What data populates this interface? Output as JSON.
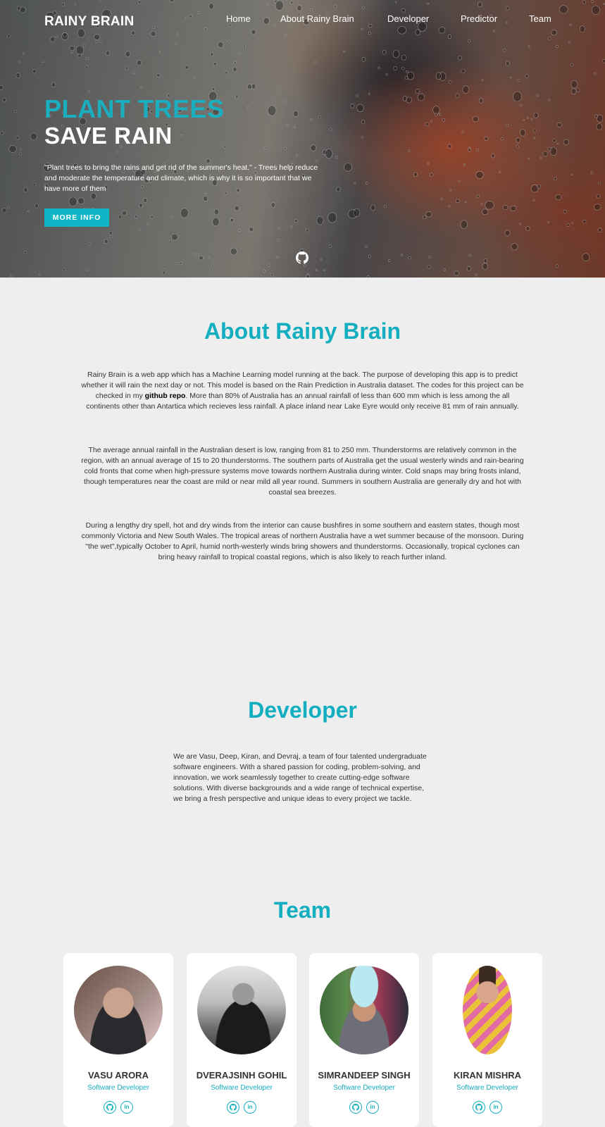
{
  "header": {
    "brand": "RAINY BRAIN",
    "nav": [
      "Home",
      "About Rainy Brain",
      "Developer",
      "Predictor",
      "Team"
    ]
  },
  "hero": {
    "headline_1": "PLANT TREES",
    "headline_2": "SAVE RAIN",
    "text": "\"Plant trees to bring the rains and get rid of the summer's heat.\" - Trees help reduce and moderate the temperature and climate, which is why it is so important that we have more of them",
    "button": "MORE INFO",
    "accent": "#1aaebe"
  },
  "about": {
    "title": "About Rainy Brain",
    "p1_before": "Rainy Brain is a web app which has a Machine Learning model running at the back. The purpose of developing this app is to predict whether it will rain the next day or not. This model is based on the Rain Prediction in Australia dataset. The codes for this project can be checked in my ",
    "p1_link": "github repo",
    "p1_after": ". More than 80% of Australia has an annual rainfall of less than 600 mm which is less among the all continents other than Antartica which recieves less rainfall. A place inland near Lake Eyre would only receive 81 mm of rain annually.",
    "p2": "The average annual rainfall in the Australian desert is low, ranging from 81 to 250 mm. Thunderstorms are relatively common in the region, with an annual average of 15 to 20 thunderstorms. The southern parts of Australia get the usual westerly winds and rain-bearing cold fronts that come when high-pressure systems move towards northern Australia during winter. Cold snaps may bring frosts inland, though temperatures near the coast are mild or near mild all year round. Summers in southern Australia are generally dry and hot with coastal sea breezes.",
    "p3": "During a lengthy dry spell, hot and dry winds from the interior can cause bushfires in some southern and eastern states, though most commonly Victoria and New South Wales. The tropical areas of northern Australia have a wet summer because of the monsoon. During \"the wet\",typically October to April, humid north-westerly winds bring showers and thunderstorms. Occasionally, tropical cyclones can bring heavy rainfall to tropical coastal regions, which is also likely to reach further inland."
  },
  "developer": {
    "title": "Developer",
    "text": "We are Vasu, Deep, Kiran, and Devraj, a team of four talented undergraduate software engineers. With a shared passion for coding, problem-solving, and innovation, we work seamlessly together to create cutting-edge software solutions. With diverse backgrounds and a wide range of technical expertise, we bring a fresh perspective and unique ideas to every project we tackle."
  },
  "team": {
    "title": "Team",
    "members": [
      {
        "name": "VASU ARORA",
        "role": "Software Developer"
      },
      {
        "name": "DVERAJSINH GOHIL",
        "role": "Software Developer"
      },
      {
        "name": "SIMRANDEEP SINGH",
        "role": "Software Developer"
      },
      {
        "name": "KIRAN MISHRA",
        "role": "Software Developer"
      }
    ],
    "social_icons": [
      "github-icon",
      "linkedin-icon"
    ],
    "linkedin_glyph": "in"
  }
}
